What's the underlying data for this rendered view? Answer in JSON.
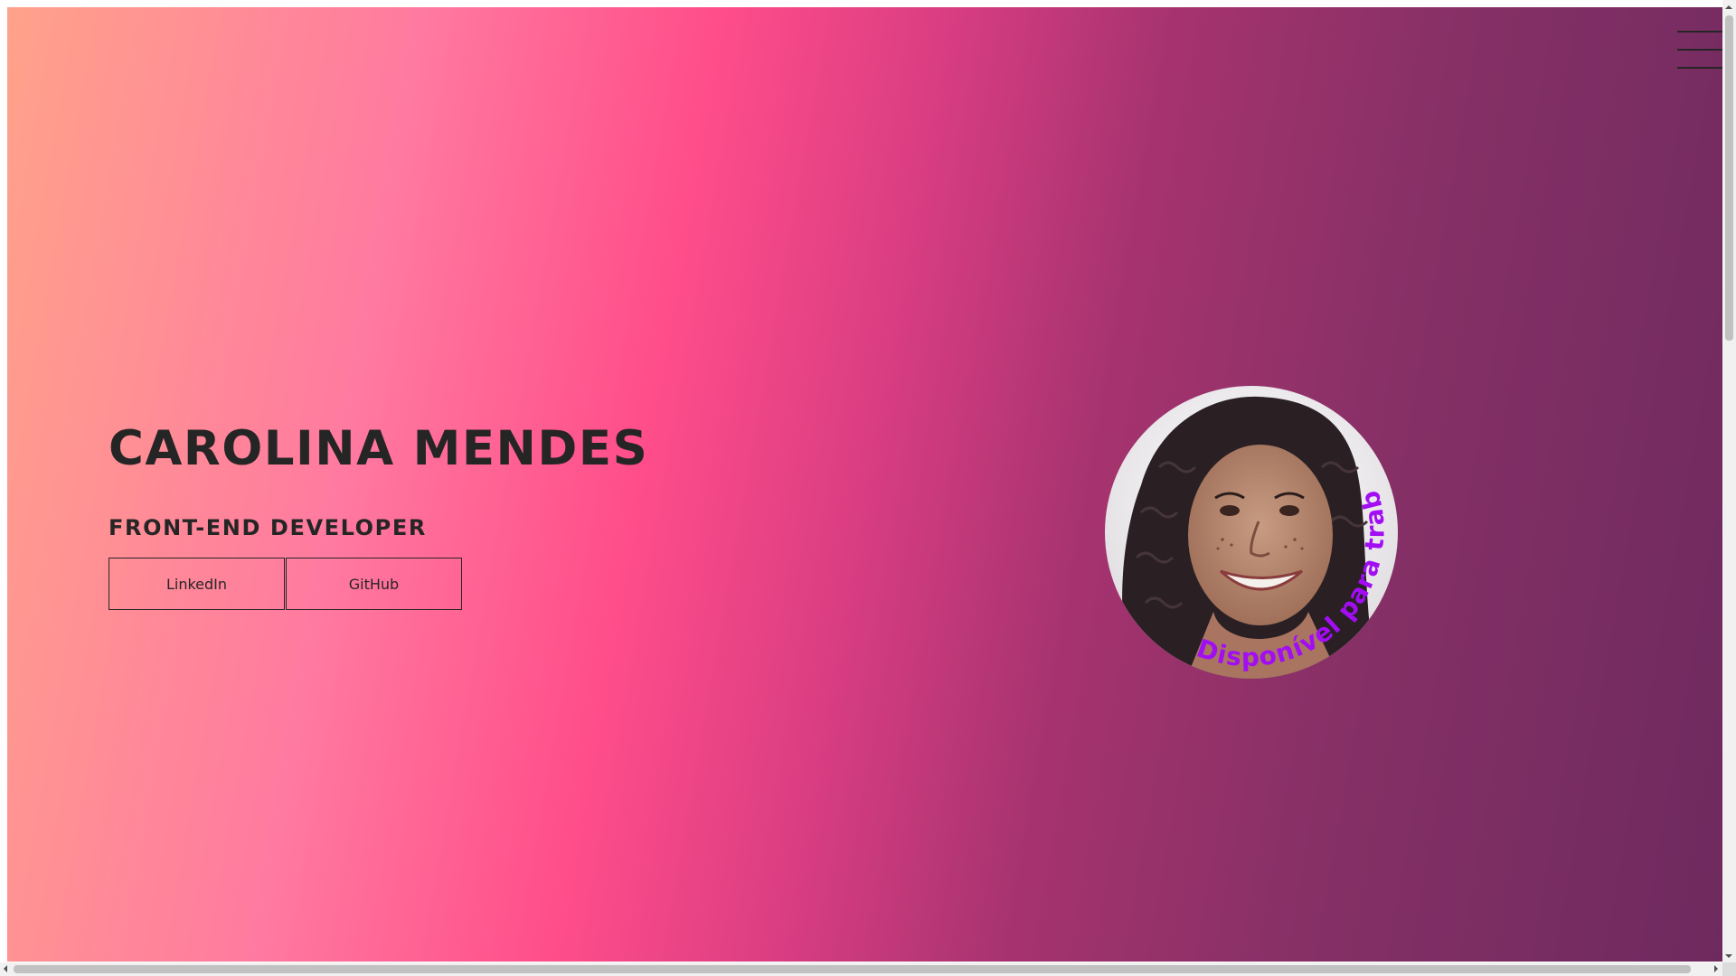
{
  "hero": {
    "name": "CAROLINA MENDES",
    "role": "FRONT-END DEVELOPER",
    "buttons": [
      {
        "label": "LinkedIn"
      },
      {
        "label": "GitHub"
      }
    ]
  },
  "avatar": {
    "badge_text": "Disponível para trabalhar",
    "badge_color": "#a20df4"
  },
  "colors": {
    "gradient_start": "#ffa28a",
    "gradient_mid": "#ff4d8a",
    "gradient_end": "#6e2a5e",
    "text": "#262526"
  },
  "icons": {
    "menu": "hamburger-menu-icon"
  }
}
